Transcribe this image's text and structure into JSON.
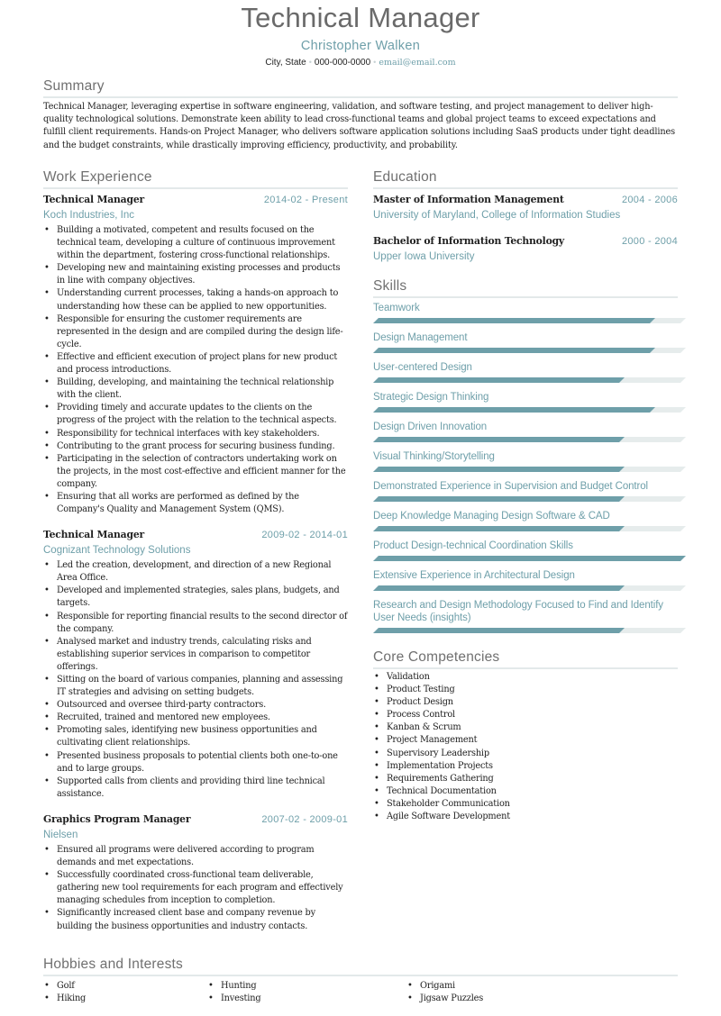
{
  "header": {
    "title": "Technical Manager",
    "name": "Christopher Walken",
    "location": "City, State",
    "phone": "000-000-0000",
    "email": "email@email.com",
    "separator": "•"
  },
  "colors": {
    "accent": "#6e9fa9",
    "heading": "#707070",
    "rule": "#e3e9ea",
    "bar_track": "#e6ecec"
  },
  "summary": {
    "heading": "Summary",
    "text": "Technical  Manager, leveraging expertise in software engineering, validation, and software testing, and project management to deliver high-quality technological solutions. Demonstrate keen ability to lead cross-functional teams and global project teams to exceed expectations and fulfill client requirements. Hands-on Project Manager, who delivers software application solutions including SaaS products under tight deadlines and the budget constraints, while drastically improving efficiency, productivity, and probability."
  },
  "work": {
    "heading": "Work Experience",
    "jobs": [
      {
        "title": "Technical Manager",
        "dates": "2014-02 - Present",
        "company": "Koch Industries, Inc",
        "bullets": [
          "Building a motivated, competent and results focused on the technical team, developing a culture of continuous improvement within the department, fostering cross-functional relationships.",
          "Developing new and maintaining existing processes and products in line with company objectives.",
          "Understanding current processes, taking a hands-on approach to understanding how these can be applied to new opportunities.",
          "Responsible for ensuring the customer requirements are represented in the design and are compiled during the design life-cycle.",
          "Effective and efficient execution of project plans for new product and process introductions.",
          "Building, developing, and maintaining the technical relationship with the client.",
          "Providing timely and accurate updates to the clients on the progress of the project with the relation to the technical aspects.",
          "Responsibility for technical interfaces with key stakeholders.",
          "Contributing to the grant process for securing business funding.",
          "Participating in the selection of contractors undertaking work on the projects, in the most cost-effective and efficient manner for the company.",
          "Ensuring that all works are performed as defined by the Company's Quality and Management System (QMS)."
        ]
      },
      {
        "title": "Technical Manager",
        "dates": "2009-02 - 2014-01",
        "company": "Cognizant Technology Solutions",
        "bullets": [
          "Led the creation, development, and direction of a new Regional Area Office.",
          "Developed and implemented strategies, sales plans, budgets, and targets.",
          "Responsible for reporting financial results to the second director of the company.",
          "Analysed market and industry trends, calculating risks and establishing superior services in comparison to competitor offerings.",
          "Sitting on the board of various companies, planning and assessing IT strategies and advising on setting budgets.",
          "Outsourced and oversee third-party contractors.",
          "Recruited, trained and mentored new employees.",
          "Promoting sales, identifying new business opportunities and cultivating client relationships.",
          "Presented business proposals to potential clients both one-to-one and to large groups.",
          "Supported calls from clients and providing third line technical assistance."
        ]
      },
      {
        "title": "Graphics Program Manager",
        "dates": "2007-02 - 2009-01",
        "company": "Nielsen",
        "bullets": [
          "Ensured all programs were delivered according to program demands and met expectations.",
          "Successfully coordinated cross-functional team deliverable, gathering new tool requirements for each program and effectively managing schedules from inception to completion.",
          "Significantly increased client base and company revenue by building the business opportunities and industry contacts."
        ]
      }
    ]
  },
  "education": {
    "heading": "Education",
    "items": [
      {
        "degree": "Master of Information Management",
        "dates": "2004 - 2006",
        "school": "University of Maryland, College of Information Studies"
      },
      {
        "degree": "Bachelor of Information Technology",
        "dates": "2000 - 2004",
        "school": "Upper Iowa University"
      }
    ]
  },
  "skills": {
    "heading": "Skills",
    "items": [
      {
        "label": "Teamwork",
        "level_percent": 90
      },
      {
        "label": "Design Management",
        "level_percent": 90
      },
      {
        "label": "User-centered Design",
        "level_percent": 80
      },
      {
        "label": "Strategic Design Thinking",
        "level_percent": 90
      },
      {
        "label": "Design Driven Innovation",
        "level_percent": 80
      },
      {
        "label": "Visual Thinking/Storytelling",
        "level_percent": 80
      },
      {
        "label": "Demonstrated Experience in Supervision and Budget Control",
        "level_percent": 80
      },
      {
        "label": "Deep Knowledge Managing Design Software & CAD",
        "level_percent": 80
      },
      {
        "label": "Product Design-technical Coordination Skills",
        "level_percent": 100
      },
      {
        "label": "Extensive Experience in Architectural Design",
        "level_percent": 80
      },
      {
        "label": "Research and Design Methodology Focused to Find and Identify User Needs (insights)",
        "level_percent": 80
      }
    ]
  },
  "core": {
    "heading": "Core Competencies",
    "items": [
      "Validation",
      "Product Testing",
      "Product Design",
      "Process Control",
      "Kanban & Scrum",
      "Project Management",
      "Supervisory Leadership",
      "Implementation Projects",
      "Requirements Gathering",
      "Technical Documentation",
      "Stakeholder Communication",
      "Agile Software Development"
    ]
  },
  "hobbies": {
    "heading": "Hobbies and Interests",
    "columns": [
      [
        "Golf",
        "Hiking"
      ],
      [
        "Hunting",
        "Investing"
      ],
      [
        "Origami",
        "Jigsaw Puzzles"
      ]
    ]
  }
}
